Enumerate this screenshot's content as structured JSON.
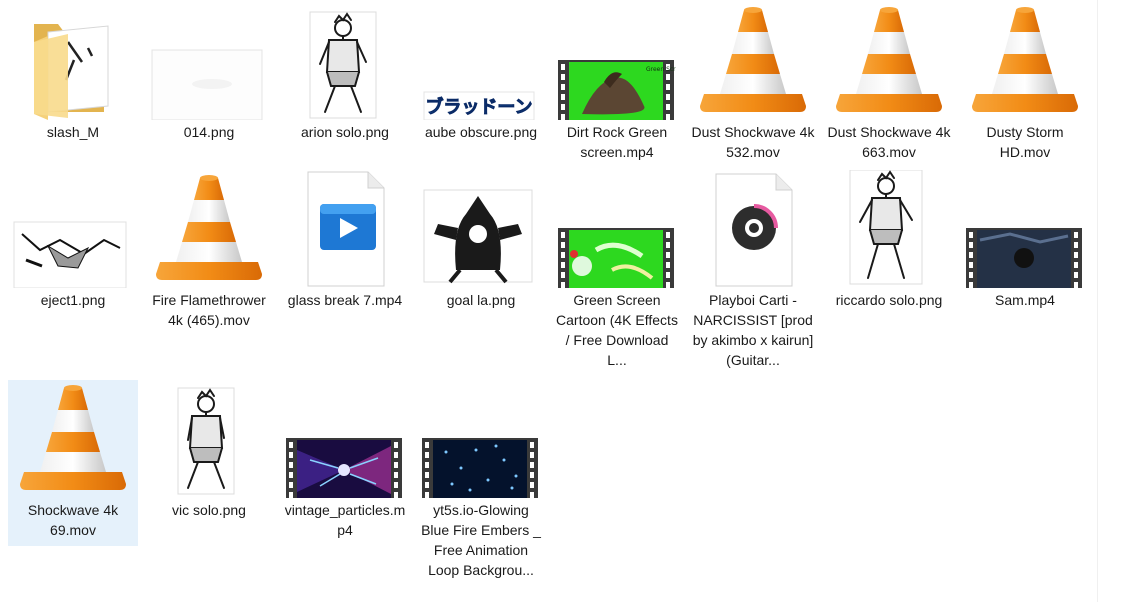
{
  "files": [
    {
      "name": "slash_M",
      "type": "folder"
    },
    {
      "name": "014.png",
      "type": "image-blank"
    },
    {
      "name": "arion solo.png",
      "type": "image-character"
    },
    {
      "name": "aube obscure.png",
      "type": "image-text-logo"
    },
    {
      "name": "Dirt Rock Green screen.mp4",
      "type": "video-green-dirt"
    },
    {
      "name": "Dust Shockwave 4k 532.mov",
      "type": "vlc"
    },
    {
      "name": "Dust Shockwave 4k 663.mov",
      "type": "vlc"
    },
    {
      "name": "Dusty Storm HD.mov",
      "type": "vlc"
    },
    {
      "name": "eject1.png",
      "type": "image-eject"
    },
    {
      "name": "Fire Flamethrower 4k (465).mov",
      "type": "vlc"
    },
    {
      "name": "glass break 7.mp4",
      "type": "media-player-doc"
    },
    {
      "name": "goal la.png",
      "type": "image-goal"
    },
    {
      "name": "Green Screen Cartoon (4K Effects / Free Download L...",
      "type": "video-green-cartoon"
    },
    {
      "name": "Playboi Carti - NARCISSIST [prod by akimbo x kairun] (Guitar...",
      "type": "audio-doc"
    },
    {
      "name": "riccardo solo.png",
      "type": "image-character"
    },
    {
      "name": "Sam.mp4",
      "type": "video-dark"
    },
    {
      "name": "Shockwave 4k 69.mov",
      "type": "vlc",
      "selected": true
    },
    {
      "name": "vic solo.png",
      "type": "image-character"
    },
    {
      "name": "vintage_particles.mp4",
      "type": "video-particles"
    },
    {
      "name": "yt5s.io-Glowing Blue Fire Embers _ Free Animation Loop Backgrou...",
      "type": "video-embers"
    }
  ],
  "colors": {
    "selection": "#e5f1fb",
    "vlc_orange": "#f08a1c",
    "folder_yellow": "#f5d17a",
    "green_screen": "#2dd81f"
  },
  "overlay_texts": {
    "aube_logo": "ブラッドーン",
    "green_screen_tag": "Green Scr"
  }
}
